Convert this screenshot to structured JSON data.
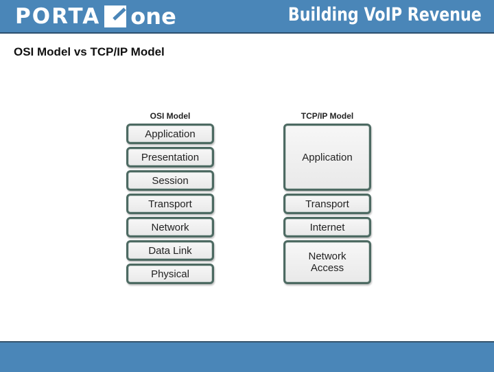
{
  "header": {
    "logo_left": "PORTA",
    "logo_right": "one",
    "tagline": "Building VoIP Revenue",
    "brand_color": "#4a86b8"
  },
  "page_title": "OSI Model vs TCP/IP Model",
  "osi": {
    "title": "OSI Model",
    "layers": [
      "Application",
      "Presentation",
      "Session",
      "Transport",
      "Network",
      "Data Link",
      "Physical"
    ]
  },
  "tcpip": {
    "title": "TCP/IP Model",
    "layers": [
      {
        "label": "Application",
        "spans_osi_layers": 3
      },
      {
        "label": "Transport",
        "spans_osi_layers": 1
      },
      {
        "label": "Internet",
        "spans_osi_layers": 1
      },
      {
        "label": "Network Access",
        "spans_osi_layers": 2
      }
    ]
  }
}
